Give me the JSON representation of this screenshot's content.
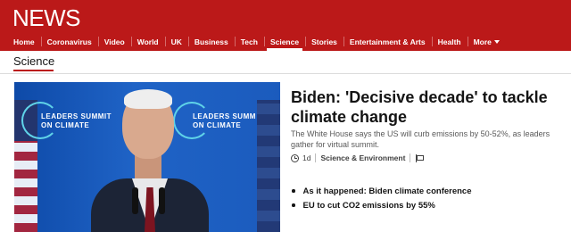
{
  "header": {
    "brand": "NEWS",
    "nav": [
      "Home",
      "Coronavirus",
      "Video",
      "World",
      "UK",
      "Business",
      "Tech",
      "Science",
      "Stories",
      "Entertainment & Arts",
      "Health"
    ],
    "active_nav": "Science",
    "more_label": "More"
  },
  "section": {
    "title": "Science"
  },
  "story": {
    "image_text_left": [
      "LEADERS SUMMIT",
      "ON CLIMATE"
    ],
    "image_text_right": [
      "LEADERS SUMM",
      "ON CLIMATE"
    ],
    "headline": "Biden: 'Decisive decade' to tackle climate change",
    "summary": "The White House says the US will curb emissions by 50-52%, as leaders gather for virtual summit.",
    "age": "1d",
    "topic": "Science & Environment",
    "related": [
      "As it happened: Biden climate conference",
      "EU to cut CO2 emissions by 55%"
    ]
  },
  "colors": {
    "brand_red": "#bb1919",
    "text": "#141414",
    "muted": "#5a5a5a"
  },
  "icons": [
    "caret-down-icon",
    "clock-icon",
    "flag-icon",
    "bullet-icon"
  ]
}
